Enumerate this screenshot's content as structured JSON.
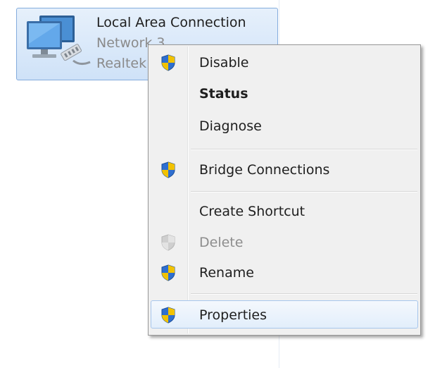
{
  "adapter": {
    "name": "Local Area Connection",
    "network": "Network 3",
    "device": "Realtek"
  },
  "context_menu": {
    "items": [
      {
        "label": "Disable",
        "icon": "uac-shield-icon",
        "bold": false,
        "disabled": false
      },
      {
        "label": "Status",
        "icon": "",
        "bold": true,
        "disabled": false
      },
      {
        "label": "Diagnose",
        "icon": "",
        "bold": false,
        "disabled": false
      },
      {
        "label": "Bridge Connections",
        "icon": "uac-shield-icon",
        "bold": false,
        "disabled": false
      },
      {
        "label": "Create Shortcut",
        "icon": "",
        "bold": false,
        "disabled": false
      },
      {
        "label": "Delete",
        "icon": "uac-shield-icon",
        "bold": false,
        "disabled": true
      },
      {
        "label": "Rename",
        "icon": "uac-shield-icon",
        "bold": false,
        "disabled": false
      },
      {
        "label": "Properties",
        "icon": "uac-shield-icon",
        "bold": false,
        "disabled": false,
        "highlighted": true
      }
    ]
  },
  "colors": {
    "selection_border": "#84acdd",
    "menu_background": "#f0f0f0",
    "shield_blue": "#2f6fd0",
    "shield_yellow": "#f2c200"
  }
}
